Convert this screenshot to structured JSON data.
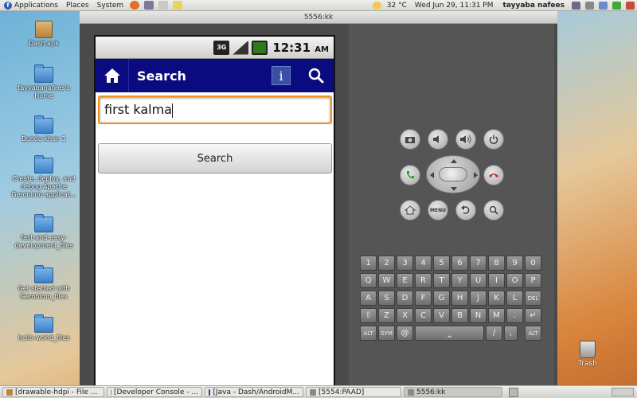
{
  "top_panel": {
    "menus": [
      "Applications",
      "Places",
      "System"
    ],
    "weather": "32 °C",
    "datetime": "Wed Jun 29, 11:31 PM",
    "user": "tayyaba nafees"
  },
  "desktop_icons": [
    {
      "label": "Dash.apk",
      "type": "package"
    },
    {
      "label": "tayyabanafees's Home",
      "type": "home"
    },
    {
      "label": "Bundu khan 1",
      "type": "folder"
    },
    {
      "label": "Create, deploy, and debug Apache Geronimo applicat...",
      "type": "folder"
    },
    {
      "label": "fast-and-easy-development_files",
      "type": "folder"
    },
    {
      "label": "Get started with Geronimo_files",
      "type": "folder"
    },
    {
      "label": "hello-world_files",
      "type": "folder"
    }
  ],
  "trash_label": "Trash",
  "emulator": {
    "window_title": "5556:kk",
    "status_bar": {
      "network": "3G",
      "time": "12:31",
      "ampm": "AM"
    },
    "action_bar": {
      "title": "Search",
      "info_label": "i"
    },
    "search_field": {
      "value": "first kalma"
    },
    "search_button_label": "Search",
    "hw_buttons": {
      "menu_label": "MENU"
    },
    "keyboard": {
      "row1": [
        "1",
        "2",
        "3",
        "4",
        "5",
        "6",
        "7",
        "8",
        "9",
        "0"
      ],
      "row2": [
        "Q",
        "W",
        "E",
        "R",
        "T",
        "Y",
        "U",
        "I",
        "O",
        "P"
      ],
      "row3": [
        "A",
        "S",
        "D",
        "F",
        "G",
        "H",
        "J",
        "K",
        "L",
        "DEL"
      ],
      "row4": [
        "Z",
        "X",
        "C",
        "V",
        "B",
        "N",
        "M",
        "."
      ],
      "row5": [
        "ALT",
        "SYM",
        "@",
        "/",
        "?",
        ",",
        "ALT"
      ]
    }
  },
  "taskbar": [
    {
      "label": "[drawable-hdpi - File ...",
      "active": false
    },
    {
      "label": "[Developer Console - ...",
      "active": false
    },
    {
      "label": "[Java - Dash/AndroidM...",
      "active": false
    },
    {
      "label": "[5554:PAAD]",
      "active": false
    },
    {
      "label": "5556:kk",
      "active": true
    }
  ]
}
